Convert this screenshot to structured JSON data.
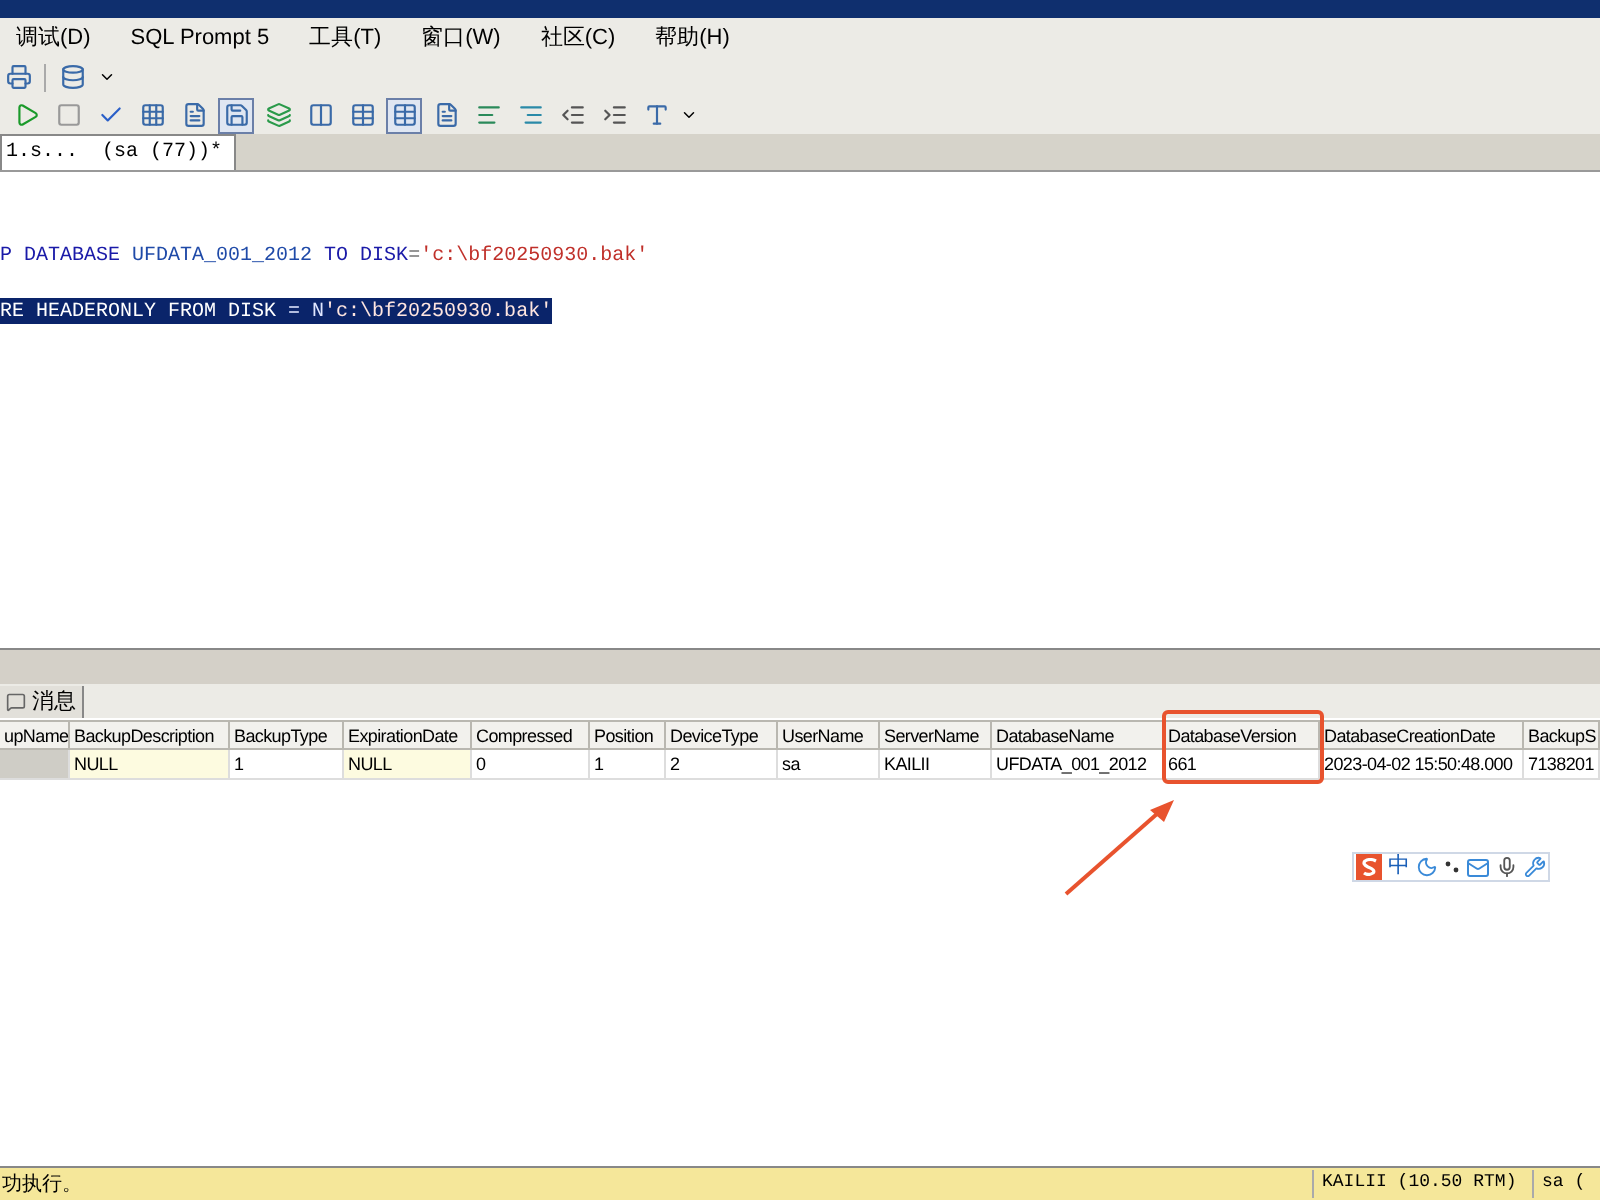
{
  "menu": [
    "调试(D)",
    "SQL Prompt 5",
    "工具(T)",
    "窗口(W)",
    "社区(C)",
    "帮助(H)"
  ],
  "document_tab": {
    "label": "1.s...  (sa (77))*",
    "selected": true
  },
  "editor": {
    "lines": [
      {
        "selected": false,
        "tokens": [
          {
            "kind": "keyword",
            "text": "P DATABASE"
          },
          {
            "kind": "plain",
            "text": " UFDATA_001_2012 "
          },
          {
            "kind": "keyword",
            "text": "TO DISK"
          },
          {
            "kind": "operator",
            "text": "="
          },
          {
            "kind": "string",
            "text": "'c:\\bf20250930.bak'"
          }
        ]
      },
      {
        "selected": true,
        "tokens": [
          {
            "kind": "keyword",
            "text": "RE HEADERONLY FROM DISK"
          },
          {
            "kind": "plain",
            "text": " = N"
          },
          {
            "kind": "string",
            "text": "'c:\\bf20250930.bak'"
          }
        ]
      }
    ]
  },
  "results_tabs": [
    {
      "label": "消息",
      "selected": false
    }
  ],
  "grid": {
    "columns": [
      {
        "label": "upName",
        "highlighted": false
      },
      {
        "label": "BackupDescription",
        "highlighted": false
      },
      {
        "label": "BackupType",
        "highlighted": false
      },
      {
        "label": "ExpirationDate",
        "highlighted": false
      },
      {
        "label": "Compressed",
        "highlighted": false
      },
      {
        "label": "Position",
        "highlighted": false
      },
      {
        "label": "DeviceType",
        "highlighted": false
      },
      {
        "label": "UserName",
        "highlighted": false
      },
      {
        "label": "ServerName",
        "highlighted": false
      },
      {
        "label": "DatabaseName",
        "highlighted": false
      },
      {
        "label": "DatabaseVersion",
        "highlighted": true
      },
      {
        "label": "DatabaseCreationDate",
        "highlighted": false
      },
      {
        "label": "BackupS",
        "highlighted": false
      }
    ],
    "rows": [
      [
        "",
        "NULL",
        "1",
        "NULL",
        "0",
        "1",
        "2",
        "sa",
        "KAILII",
        "UFDATA_001_2012",
        "661",
        "2023-04-02 15:50:48.000",
        "7138201"
      ]
    ]
  },
  "ime_toolbar": {
    "mode": "中"
  },
  "status_bar": {
    "message": "功执行。",
    "server": "KAILII (10.50 RTM)",
    "user": "sa ("
  }
}
